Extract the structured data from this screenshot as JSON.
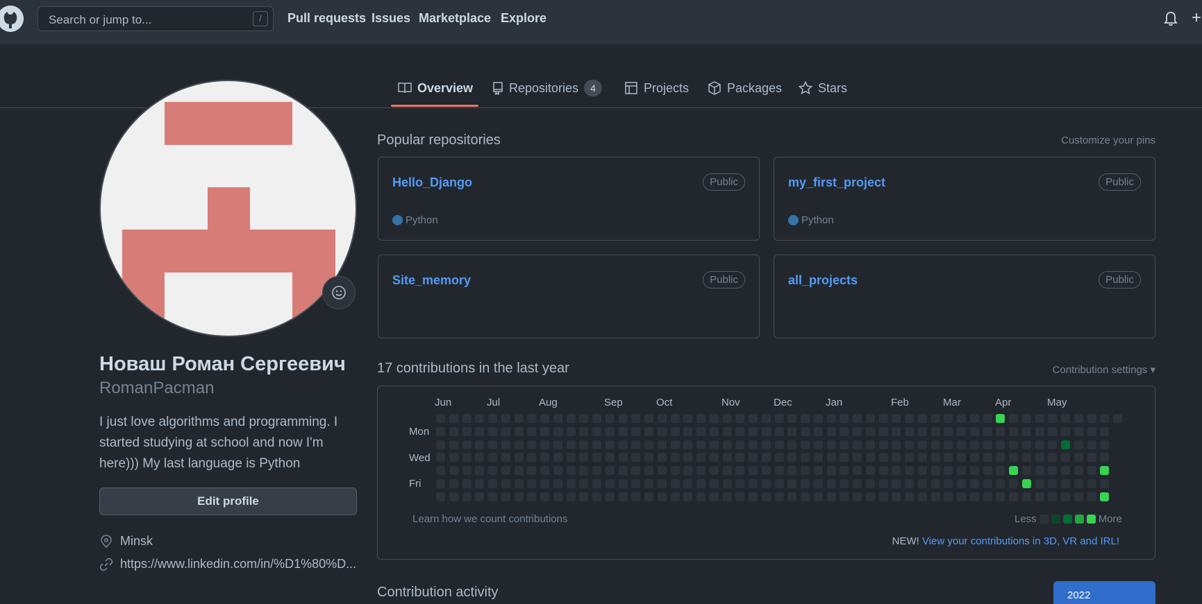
{
  "header": {
    "search_placeholder": "Search or jump to...",
    "search_shortcut": "/",
    "nav": [
      "Pull requests",
      "Issues",
      "Marketplace",
      "Explore"
    ]
  },
  "tabs": [
    {
      "label": "Overview",
      "icon": "book-icon",
      "active": true
    },
    {
      "label": "Repositories",
      "icon": "repo-icon",
      "count": "4"
    },
    {
      "label": "Projects",
      "icon": "table-icon"
    },
    {
      "label": "Packages",
      "icon": "package-icon"
    },
    {
      "label": "Stars",
      "icon": "star-icon"
    }
  ],
  "profile": {
    "full_name": "Новаш Роман Сергеевич",
    "username": "RomanPacman",
    "bio": "I just love algorithms and programming. I started studying at school and now I'm here))) My last language is Python",
    "edit_label": "Edit profile",
    "location": "Minsk",
    "link": "https://www.linkedin.com/in/%D1%80%D..."
  },
  "popular": {
    "title": "Popular repositories",
    "customize": "Customize your pins",
    "repos": [
      {
        "name": "Hello_Django",
        "visibility": "Public",
        "language": "Python",
        "lang_color": "#3572a5"
      },
      {
        "name": "my_first_project",
        "visibility": "Public",
        "language": "Python",
        "lang_color": "#3572a5"
      },
      {
        "name": "Site_memory",
        "visibility": "Public",
        "language": ""
      },
      {
        "name": "all_projects",
        "visibility": "Public",
        "language": ""
      }
    ]
  },
  "contributions": {
    "title": "17 contributions in the last year",
    "settings": "Contribution settings",
    "months": [
      "Jun",
      "Jul",
      "Aug",
      "Sep",
      "Oct",
      "Nov",
      "Dec",
      "Jan",
      "Feb",
      "Mar",
      "Apr",
      "May"
    ],
    "days": [
      "Mon",
      "Wed",
      "Fri"
    ],
    "learn": "Learn how we count contributions",
    "less": "Less",
    "more": "More",
    "new_prefix": "NEW!",
    "new_link": "View your contributions in 3D, VR and IRL!",
    "level_colors": [
      "#2d333b",
      "#0e4429",
      "#006d32",
      "#26a641",
      "#39d353"
    ],
    "active_cells": [
      {
        "week": 43,
        "day": 0,
        "level": 4
      },
      {
        "week": 48,
        "day": 2,
        "level": 2
      },
      {
        "week": 44,
        "day": 4,
        "level": 4
      },
      {
        "week": 51,
        "day": 4,
        "level": 4
      },
      {
        "week": 45,
        "day": 5,
        "level": 4
      },
      {
        "week": 51,
        "day": 6,
        "level": 4
      }
    ]
  },
  "activity": {
    "title": "Contribution activity",
    "year": "2022"
  }
}
